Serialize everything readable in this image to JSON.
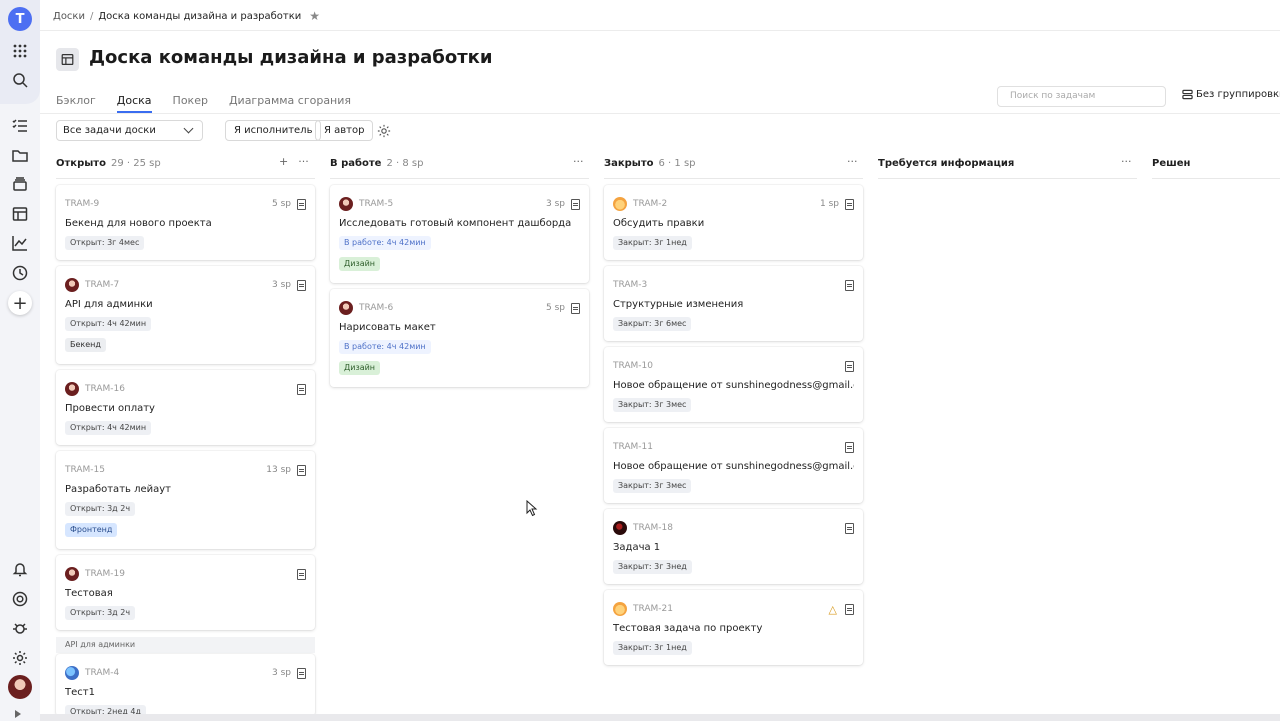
{
  "breadcrumb": {
    "root": "Доски",
    "separator": "/",
    "current": "Доска команды дизайна и разработки"
  },
  "page_title": "Доска команды дизайна и разработки",
  "tabs": [
    {
      "label": "Бэклог",
      "active": false
    },
    {
      "label": "Доска",
      "active": true
    },
    {
      "label": "Покер",
      "active": false
    },
    {
      "label": "Диаграмма сгорания",
      "active": false
    }
  ],
  "search": {
    "placeholder": "Поиск по задачам"
  },
  "grouping": {
    "label": "Без группировки"
  },
  "filters": {
    "select_value": "Все задачи доски",
    "assignee_btn": "Я исполнитель",
    "author_btn": "Я автор"
  },
  "columns": [
    {
      "name": "Открыто",
      "meta": "29 · 25 sp"
    },
    {
      "name": "В работе",
      "meta": "2 · 8 sp"
    },
    {
      "name": "Закрыто",
      "meta": "6 · 1 sp"
    },
    {
      "name": "Требуется информация",
      "meta": ""
    },
    {
      "name": "Решен",
      "meta": ""
    }
  ],
  "cards": {
    "open": [
      {
        "key": "TRAM-9",
        "sp": "5 sp",
        "title": "Бекенд для нового проекта",
        "status": "Открыт: 3г 4мес"
      },
      {
        "key": "TRAM-7",
        "sp": "3 sp",
        "title": "API для админки",
        "status": "Открыт: 4ч 42мин",
        "tag": "Бекенд"
      },
      {
        "key": "TRAM-16",
        "sp": "",
        "title": "Провести оплату",
        "status": "Открыт: 4ч 42мин"
      },
      {
        "key": "TRAM-15",
        "sp": "13 sp",
        "title": "Разработать лейаут",
        "status": "Открыт: 3д 2ч",
        "tag": "Фронтенд"
      },
      {
        "key": "TRAM-19",
        "sp": "",
        "title": "Тестовая",
        "status": "Открыт: 3д 2ч"
      },
      {
        "key": "TRAM-4",
        "sp": "3 sp",
        "title": "Тест1",
        "status": "Открыт: 2нед 4д"
      }
    ],
    "group_label": "API для админки",
    "in_work": [
      {
        "key": "TRAM-5",
        "sp": "3 sp",
        "title": "Исследовать готовый компонент дашборда",
        "status": "В работе: 4ч 42мин",
        "tag": "Дизайн"
      },
      {
        "key": "TRAM-6",
        "sp": "5 sp",
        "title": "Нарисовать макет",
        "status": "В работе: 4ч 42мин",
        "tag": "Дизайн"
      }
    ],
    "closed": [
      {
        "key": "TRAM-2",
        "sp": "1 sp",
        "title": "Обсудить правки",
        "status": "Закрыт: 3г 1нед"
      },
      {
        "key": "TRAM-3",
        "sp": "",
        "title": "Структурные изменения",
        "status": "Закрыт: 3г 6мес"
      },
      {
        "key": "TRAM-10",
        "sp": "",
        "title": "Новое обращение от sunshinegodness@gmail.com",
        "status": "Закрыт: 3г 3мес"
      },
      {
        "key": "TRAM-11",
        "sp": "",
        "title": "Новое обращение от sunshinegodness@gmail.com",
        "status": "Закрыт: 3г 3мес"
      },
      {
        "key": "TRAM-18",
        "sp": "",
        "title": "Задача 1",
        "status": "Закрыт: 3г 3нед"
      },
      {
        "key": "TRAM-21",
        "sp": "",
        "title": "Тестовая задача по проекту",
        "status": "Закрыт: 3г 1нед"
      }
    ]
  },
  "logo_letter": "T",
  "accent_color": "#3a6df0"
}
